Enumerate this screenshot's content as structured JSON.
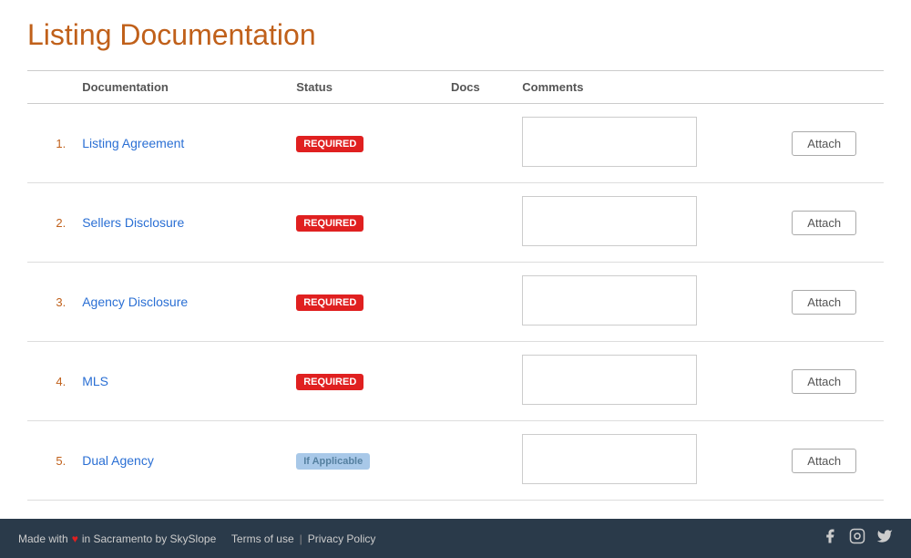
{
  "header": {
    "title": "Listing Documentation"
  },
  "table": {
    "columns": [
      "",
      "Documentation",
      "Status",
      "Docs",
      "Comments",
      "",
      ""
    ],
    "rows": [
      {
        "num": "1.",
        "name": "Listing Agreement",
        "status": "Required",
        "status_type": "required"
      },
      {
        "num": "2.",
        "name": "Sellers Disclosure",
        "status": "Required",
        "status_type": "required"
      },
      {
        "num": "3.",
        "name": "Agency Disclosure",
        "status": "Required",
        "status_type": "required"
      },
      {
        "num": "4.",
        "name": "MLS",
        "status": "Required",
        "status_type": "required"
      },
      {
        "num": "5.",
        "name": "Dual Agency",
        "status": "If Applicable",
        "status_type": "applicable"
      }
    ],
    "attach_label": "Attach"
  },
  "footer": {
    "made_with": "Made with",
    "heart": "♥",
    "location": "in Sacramento by SkySlope",
    "terms": "Terms of use",
    "privacy": "Privacy Policy"
  }
}
